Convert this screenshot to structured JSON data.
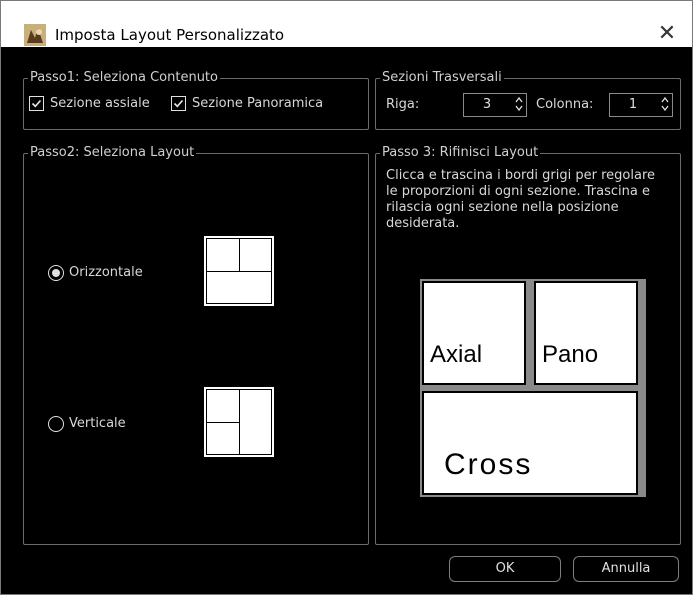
{
  "window": {
    "title": "Imposta Layout Personalizzato",
    "close_glyph": "✕"
  },
  "step1": {
    "legend": "Passo1: Seleziona Contenuto",
    "axial_label": "Sezione assiale",
    "axial_checked": true,
    "panoramic_label": "Sezione Panoramica",
    "panoramic_checked": true
  },
  "cross_sections": {
    "legend": "Sezioni Trasversali",
    "row_label": "Riga:",
    "row_value": "3",
    "col_label": "Colonna:",
    "col_value": "1"
  },
  "step2": {
    "legend": "Passo2: Seleziona Layout",
    "horizontal_label": "Orizzontale",
    "horizontal_selected": true,
    "vertical_label": "Verticale",
    "vertical_selected": false
  },
  "step3": {
    "legend": "Passo 3: Rifinisci Layout",
    "instructions": [
      "Clicca e trascina i bordi grigi per regolare",
      "le proporzioni di ogni sezione. Trascina e",
      "rilascia ogni sezione nella posizione",
      "desiderata."
    ],
    "panes": {
      "axial": "Axial",
      "pano": "Pano",
      "cross": "Cross"
    }
  },
  "buttons": {
    "ok": "OK",
    "cancel": "Annulla"
  },
  "colors": {
    "background": "#000000",
    "text": "#d8d8d8",
    "border": "#6b6b6b",
    "divider": "#8a8a8a"
  }
}
